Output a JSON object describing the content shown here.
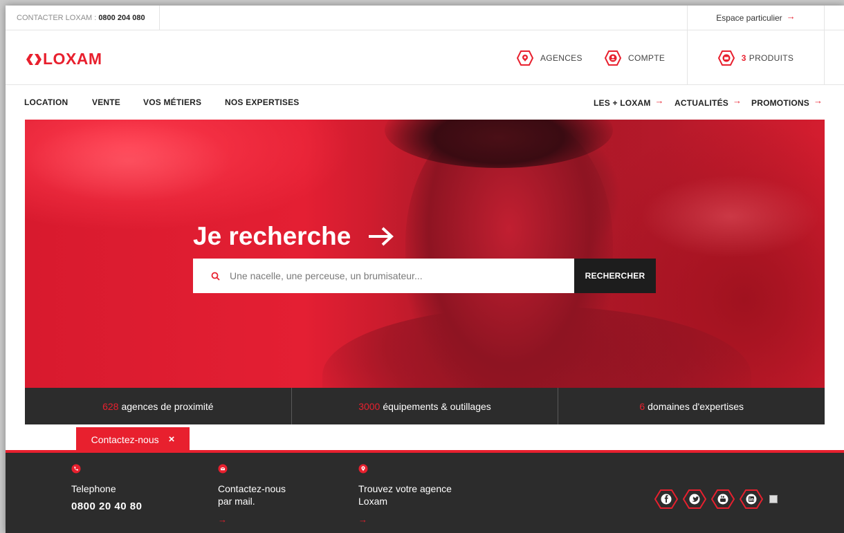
{
  "topbar": {
    "contact_label": "CONTACTER LOXAM :",
    "contact_number": "0800 204 080",
    "espace_label": "Espace particulier",
    "arrow": "→"
  },
  "header": {
    "logo_text": "LOXAM",
    "agences_label": "AGENCES",
    "compte_label": "COMPTE",
    "produits_count": "3",
    "produits_label": "PRODUITS"
  },
  "nav": {
    "location": "LOCATION",
    "vente": "VENTE",
    "metiers": "VOS MÉTIERS",
    "expertises": "NOS EXPERTISES",
    "plus_loxam": "LES + LOXAM",
    "actualites": "ACTUALITÉS",
    "promotions": "PROMOTIONS",
    "arrow": "→"
  },
  "hero": {
    "heading": "Je recherche",
    "search_placeholder": "Une nacelle, une perceuse, un brumisateur...",
    "search_button": "RECHERCHER"
  },
  "stats": [
    {
      "number": "628",
      "label": "agences de proximité"
    },
    {
      "number": "3000",
      "label": "équipements & outillages"
    },
    {
      "number": "6",
      "label": "domaines d'expertises"
    }
  ],
  "contact_tab": {
    "label": "Contactez-nous",
    "close": "×"
  },
  "footer": {
    "phone_title": "Telephone",
    "phone_number": "0800 20 40 80",
    "mail_line1": "Contactez-nous",
    "mail_line2": "par mail.",
    "agence_line1": "Trouvez votre agence",
    "agence_line2": "Loxam",
    "arrow": "→"
  },
  "social_icons": [
    "facebook-icon",
    "twitter-icon",
    "youtube-icon",
    "linkedin-icon"
  ],
  "colors": {
    "brand_red": "#e8202e",
    "dark": "#2c2c2c",
    "button_dark": "#1d1d1d"
  }
}
